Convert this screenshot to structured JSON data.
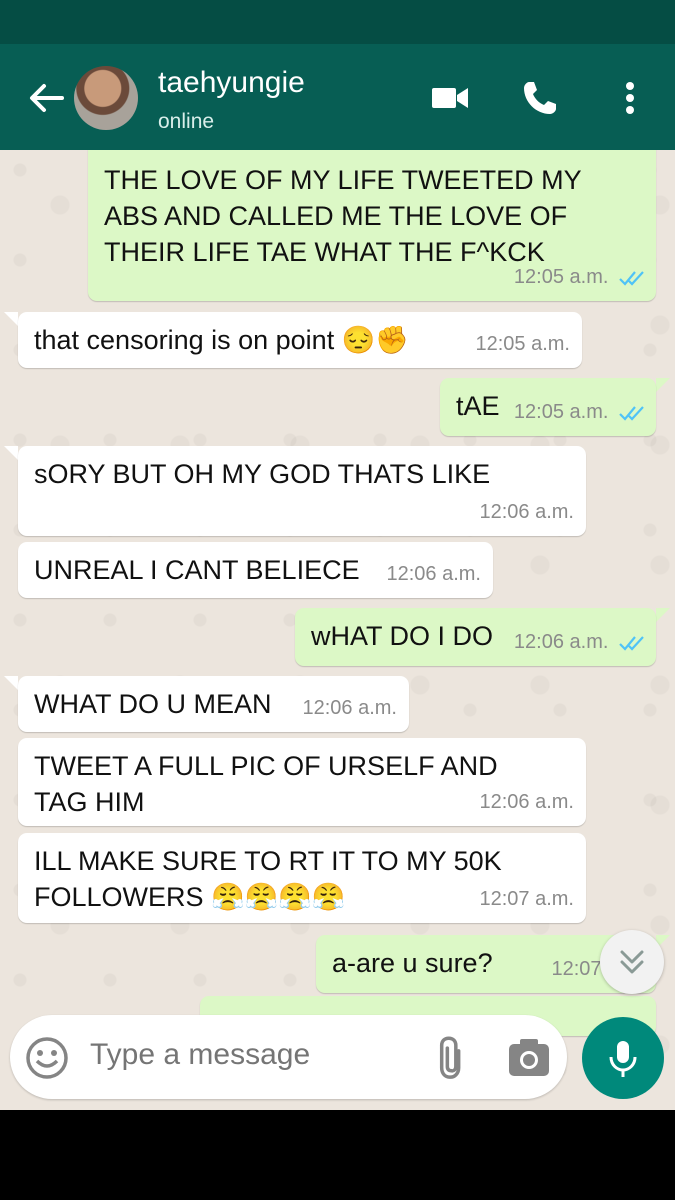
{
  "contact": {
    "name": "taehyungie",
    "status": "online"
  },
  "messages": [
    {
      "dir": "out",
      "text_lines": [
        "THE LOVE OF MY LIFE TWEETED MY",
        "ABS AND CALLED ME THE LOVE OF",
        "THEIR LIFE TAE WHAT THE F^KCK"
      ],
      "time": "12:05 a.m.",
      "read": true
    },
    {
      "dir": "in",
      "text": "that censoring is on point 😔✊",
      "time": "12:05 a.m."
    },
    {
      "dir": "out",
      "text": "tAE",
      "time": "12:05 a.m.",
      "read": true
    },
    {
      "dir": "in",
      "text": "sORY BUT OH MY GOD THATS LIKE",
      "time": "12:06 a.m."
    },
    {
      "dir": "in",
      "text": "UNREAL I CANT BELIECE",
      "time": "12:06 a.m."
    },
    {
      "dir": "out",
      "text": "wHAT DO I DO",
      "time": "12:06 a.m.",
      "read": true
    },
    {
      "dir": "in",
      "text": "WHAT DO U MEAN",
      "time": "12:06 a.m."
    },
    {
      "dir": "in",
      "text_lines": [
        "TWEET A FULL PIC OF URSELF AND",
        "TAG HIM"
      ],
      "time": "12:06 a.m."
    },
    {
      "dir": "in",
      "text_lines": [
        "ILL MAKE SURE TO RT IT TO MY 50K",
        "FOLLOWERS 😤😤😤😤"
      ],
      "time": "12:07 a.m."
    },
    {
      "dir": "out",
      "text": "a-are u sure?",
      "time": "12:07 a.m.",
      "read": true
    }
  ],
  "composer": {
    "placeholder": "Type a message"
  },
  "icons": {
    "back": "arrow-left-icon",
    "video_call": "video-camera-icon",
    "voice_call": "phone-icon",
    "menu": "more-vert-icon",
    "emoji": "smiley-icon",
    "attach": "paperclip-icon",
    "camera": "camera-icon",
    "mic": "microphone-icon",
    "scroll": "double-chevron-down-icon",
    "read_receipt": "double-check-icon"
  },
  "colors": {
    "header": "#075e54",
    "statusbar": "#054d44",
    "bubble_out": "#dcf8c6",
    "bubble_in": "#ffffff",
    "read_tick": "#4fc3f7",
    "mic_button": "#00897b"
  }
}
